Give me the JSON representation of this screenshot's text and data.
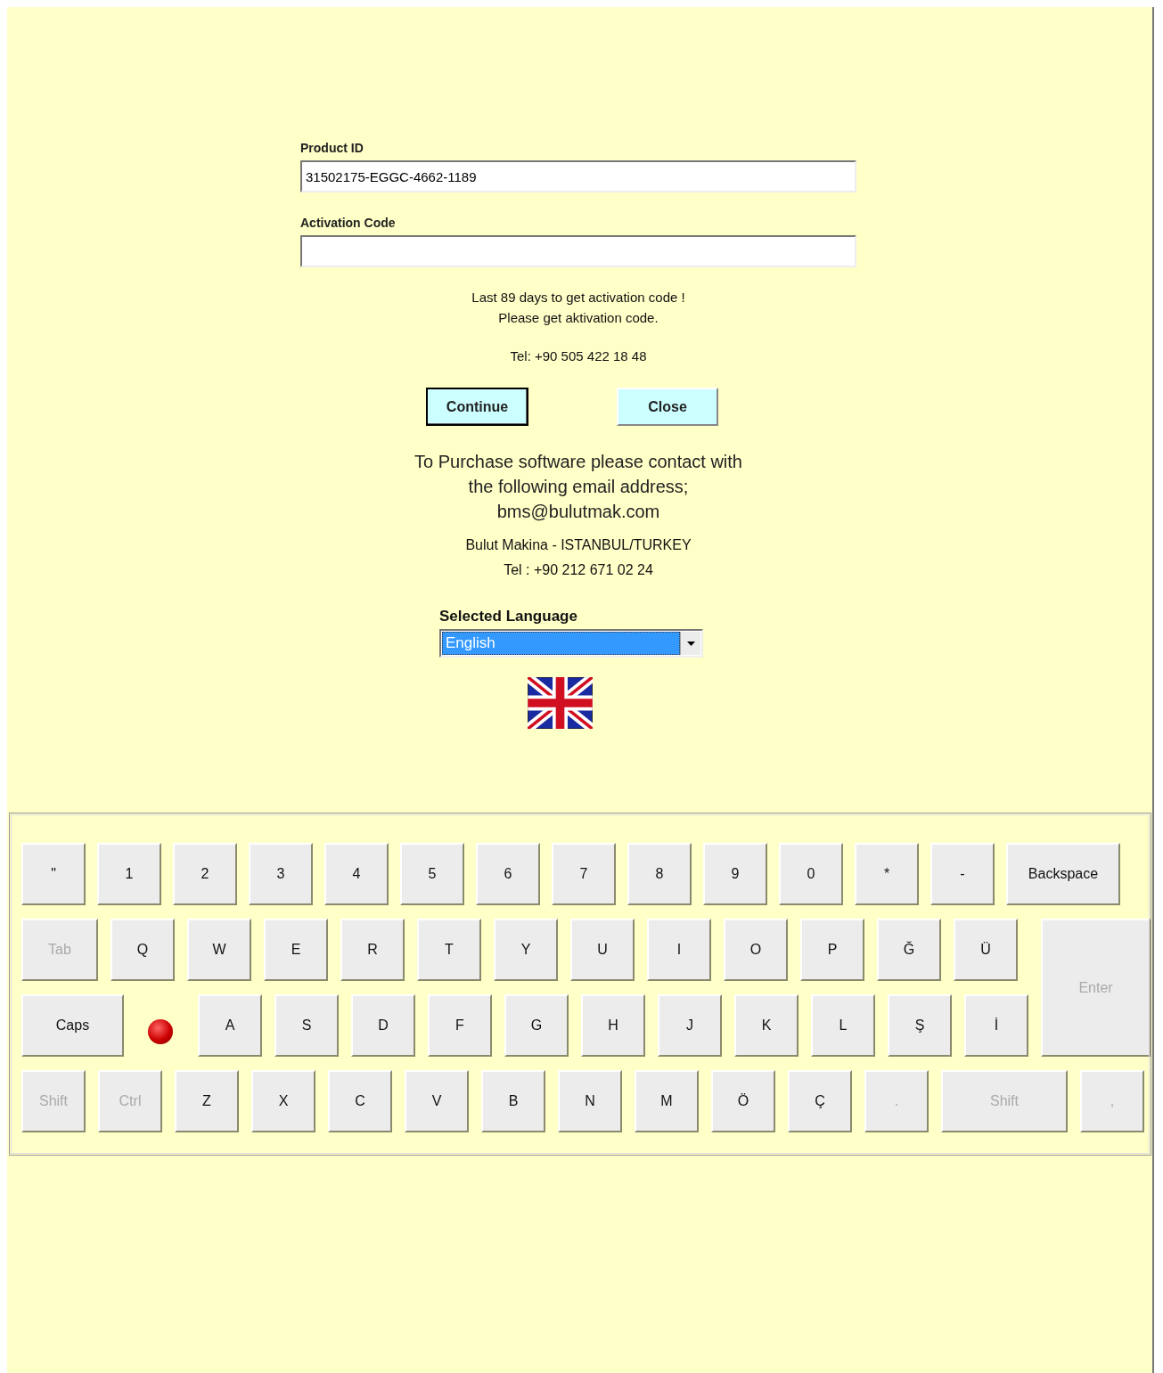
{
  "product_id": {
    "label": "Product ID",
    "value": "31502175-EGGC-4662-1189"
  },
  "activation_code": {
    "label": "Activation Code"
  },
  "notice": [
    "Last 89 days to get activation code !",
    "Please get aktivation code."
  ],
  "phone": "Tel: +90 505 422 18 48",
  "buttons": [
    {
      "label": "Continue",
      "focused": true
    },
    {
      "label": "Close",
      "focused": false
    }
  ],
  "purchase": [
    "To Purchase software please contact with",
    "the following email address;",
    "bms@bulutmak.com"
  ],
  "company": [
    "Bulut Makina - ISTANBUL/TURKEY",
    "Tel : +90 212 671 02 24"
  ],
  "language": {
    "label": "Selected Language",
    "value": "English"
  },
  "keyboard": {
    "caps_lock_on": true,
    "rows": [
      [
        {
          "label": "\"",
          "kind": "key",
          "disabled": false
        },
        {
          "label": "1",
          "kind": "key",
          "disabled": false
        },
        {
          "label": "2",
          "kind": "key",
          "disabled": false
        },
        {
          "label": "3",
          "kind": "key",
          "disabled": false
        },
        {
          "label": "4",
          "kind": "key",
          "disabled": false
        },
        {
          "label": "5",
          "kind": "key",
          "disabled": false
        },
        {
          "label": "6",
          "kind": "key",
          "disabled": false
        },
        {
          "label": "7",
          "kind": "key",
          "disabled": false
        },
        {
          "label": "8",
          "kind": "key",
          "disabled": false
        },
        {
          "label": "9",
          "kind": "key",
          "disabled": false
        },
        {
          "label": "0",
          "kind": "key",
          "disabled": false
        },
        {
          "label": "*",
          "kind": "key",
          "disabled": false
        },
        {
          "label": "-",
          "kind": "key",
          "disabled": false
        },
        {
          "label": "Backspace",
          "kind": "backspace",
          "disabled": false
        }
      ],
      [
        {
          "label": "Tab",
          "kind": "tab",
          "disabled": true
        },
        {
          "label": "Q",
          "kind": "key",
          "disabled": false
        },
        {
          "label": "W",
          "kind": "key",
          "disabled": false
        },
        {
          "label": "E",
          "kind": "key",
          "disabled": false
        },
        {
          "label": "R",
          "kind": "key",
          "disabled": false
        },
        {
          "label": "T",
          "kind": "key",
          "disabled": false
        },
        {
          "label": "Y",
          "kind": "key",
          "disabled": false
        },
        {
          "label": "U",
          "kind": "key",
          "disabled": false
        },
        {
          "label": "I",
          "kind": "key",
          "disabled": false
        },
        {
          "label": "O",
          "kind": "key",
          "disabled": false
        },
        {
          "label": "P",
          "kind": "key",
          "disabled": false
        },
        {
          "label": "Ğ",
          "kind": "key",
          "disabled": false
        },
        {
          "label": "Ü",
          "kind": "key",
          "disabled": false
        },
        {
          "label": "Enter",
          "kind": "enter",
          "disabled": true
        }
      ],
      [
        {
          "label": "Caps",
          "kind": "caps",
          "disabled": false
        },
        {
          "label": "A",
          "kind": "key",
          "disabled": false
        },
        {
          "label": "S",
          "kind": "key",
          "disabled": false
        },
        {
          "label": "D",
          "kind": "key",
          "disabled": false
        },
        {
          "label": "F",
          "kind": "key",
          "disabled": false
        },
        {
          "label": "G",
          "kind": "key",
          "disabled": false
        },
        {
          "label": "H",
          "kind": "key",
          "disabled": false
        },
        {
          "label": "J",
          "kind": "key",
          "disabled": false
        },
        {
          "label": "K",
          "kind": "key",
          "disabled": false
        },
        {
          "label": "L",
          "kind": "key",
          "disabled": false
        },
        {
          "label": "Ş",
          "kind": "key",
          "disabled": false
        },
        {
          "label": "İ",
          "kind": "key",
          "disabled": false
        }
      ],
      [
        {
          "label": "Shift",
          "kind": "key",
          "disabled": true
        },
        {
          "label": "Ctrl",
          "kind": "key",
          "disabled": true
        },
        {
          "label": "Z",
          "kind": "key",
          "disabled": false
        },
        {
          "label": "X",
          "kind": "key",
          "disabled": false
        },
        {
          "label": "C",
          "kind": "key",
          "disabled": false
        },
        {
          "label": "V",
          "kind": "key",
          "disabled": false
        },
        {
          "label": "B",
          "kind": "key",
          "disabled": false
        },
        {
          "label": "N",
          "kind": "key",
          "disabled": false
        },
        {
          "label": "M",
          "kind": "key",
          "disabled": false
        },
        {
          "label": "Ö",
          "kind": "key",
          "disabled": false
        },
        {
          "label": "Ç",
          "kind": "key",
          "disabled": false
        },
        {
          "label": ".",
          "kind": "key",
          "disabled": true
        },
        {
          "label": "Shift",
          "kind": "shift",
          "disabled": true
        },
        {
          "label": ",",
          "kind": "key",
          "disabled": true
        }
      ]
    ]
  }
}
